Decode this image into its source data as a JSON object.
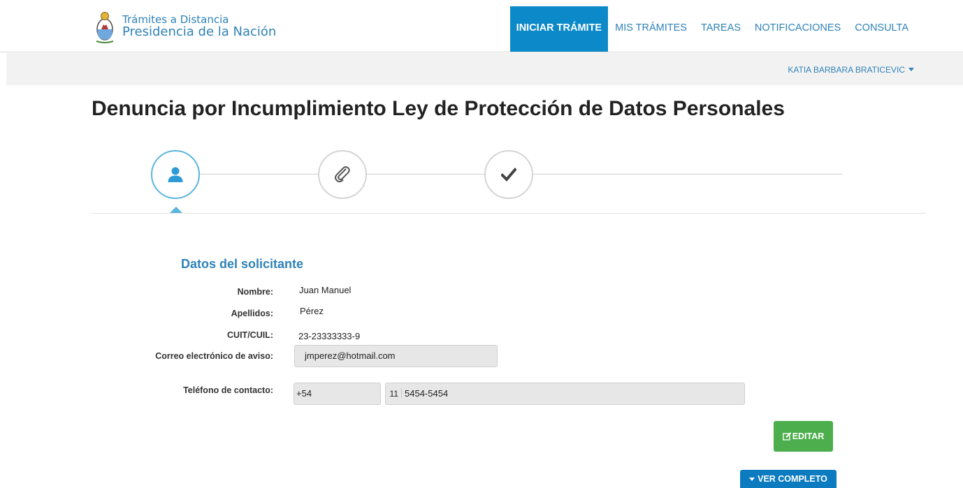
{
  "header": {
    "logo_line1": "Trámites a Distancia",
    "logo_line2": "Presidencia de la Nación",
    "nav": [
      {
        "label": "INICIAR TRÁMITE",
        "active": true
      },
      {
        "label": "MIS TRÁMITES",
        "active": false
      },
      {
        "label": "TAREAS",
        "active": false
      },
      {
        "label": "NOTIFICACIONES",
        "active": false
      },
      {
        "label": "CONSULTA",
        "active": false
      }
    ]
  },
  "userbar": {
    "user_name": "KATIA BARBARA BRATICEVIC"
  },
  "page": {
    "title": "Denuncia por Incumplimiento Ley de Protección de Datos Personales"
  },
  "stepper": {
    "steps": [
      {
        "icon": "user-icon",
        "state": "active"
      },
      {
        "icon": "paperclip-icon",
        "state": "pending"
      },
      {
        "icon": "checkmark-icon",
        "state": "pending"
      }
    ]
  },
  "form": {
    "section_title": "Datos del solicitante",
    "nombre_label": "Nombre:",
    "nombre_value": "Juan Manuel",
    "apellidos_label": "Apellidos:",
    "apellidos_value": "Pérez",
    "cuit_label": "CUIT/CUIL:",
    "cuit_value": "23-23333333-9",
    "email_label": "Correo electrónico de aviso:",
    "email_value": "jmperez@hotmail.com",
    "phone_label": "Teléfono de contacto:",
    "phone_country": "+54",
    "phone_area": "11",
    "phone_number": "5454-5454"
  },
  "actions": {
    "edit_label": "EDITAR",
    "view_more_label": "VER COMPLETO"
  },
  "colors": {
    "primary": "#0c89c8",
    "link": "#2f82b7",
    "success": "#4cae4c",
    "step_active": "#5bb4dc"
  }
}
